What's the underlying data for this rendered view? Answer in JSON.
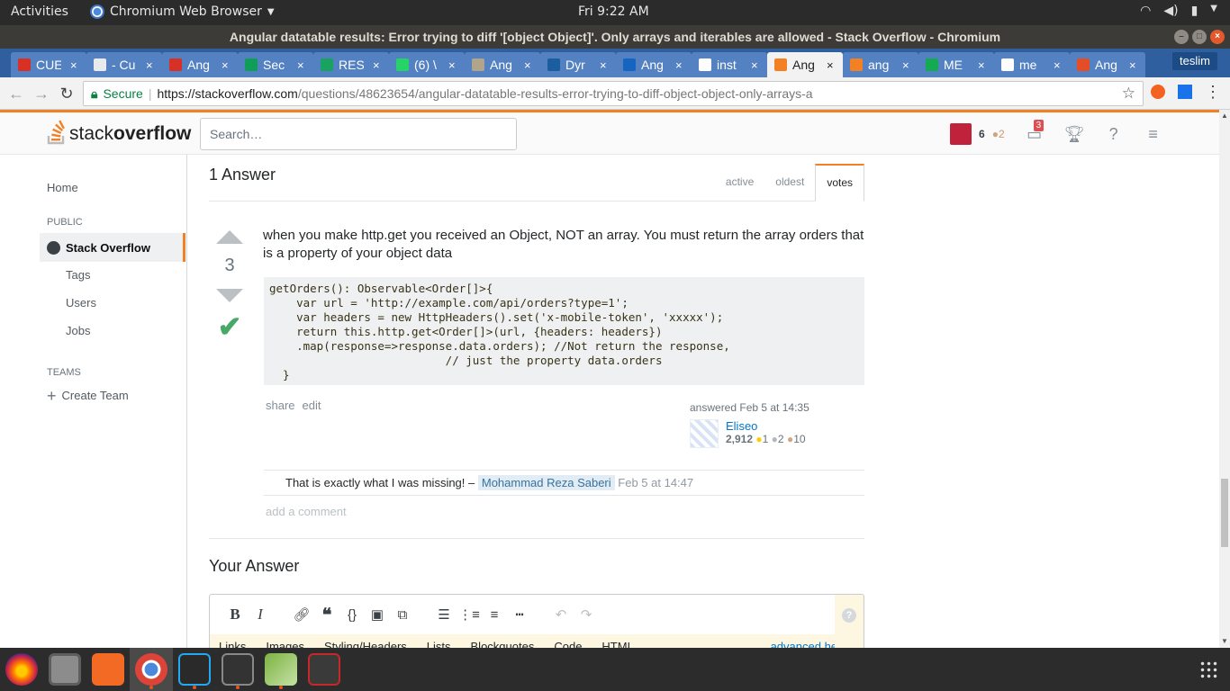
{
  "system": {
    "activities": "Activities",
    "app_name": "Chromium Web Browser",
    "clock": "Fri  9:22 AM"
  },
  "window": {
    "title": "Angular datatable results: Error trying to diff '[object Object]'. Only arrays and iterables are allowed - Stack Overflow - Chromium"
  },
  "tabs": [
    {
      "label": "CUE",
      "color": "#d93025"
    },
    {
      "label": "- Cu",
      "color": "#e8eaed"
    },
    {
      "label": "Ang",
      "color": "#d93025"
    },
    {
      "label": "Sec",
      "color": "#0f9d58"
    },
    {
      "label": "RES",
      "color": "#1aa260"
    },
    {
      "label": "(6) \\",
      "color": "#25d366"
    },
    {
      "label": "Ang",
      "color": "#b0a48a"
    },
    {
      "label": "Dyr",
      "color": "#1b5e9f"
    },
    {
      "label": "Ang",
      "color": "#1565c0"
    },
    {
      "label": "inst",
      "color": "#ffffff"
    },
    {
      "label": "Ang",
      "color": "#f48024",
      "active": true
    },
    {
      "label": "ang",
      "color": "#f48024"
    },
    {
      "label": "ME",
      "color": "#13aa52"
    },
    {
      "label": "me",
      "color": "#ffffff"
    },
    {
      "label": "Ang",
      "color": "#e44d26"
    }
  ],
  "profile": "teslim",
  "address_bar": {
    "secure_label": "Secure",
    "url_host": "https://stackoverflow.com",
    "url_path": "/questions/48623654/angular-datatable-results-error-trying-to-diff-object-object-only-arrays-a"
  },
  "so_header": {
    "logo_light": "stack",
    "logo_bold": "overflow",
    "search_placeholder": "Search…",
    "reputation": "6",
    "bronze_badges": "2",
    "inbox_count": "3"
  },
  "sidebar": {
    "home": "Home",
    "public_heading": "PUBLIC",
    "stack_overflow": "Stack Overflow",
    "tags": "Tags",
    "users": "Users",
    "jobs": "Jobs",
    "teams_heading": "TEAMS",
    "create_team": "Create Team"
  },
  "answers": {
    "count_label": "1 Answer",
    "sort_tabs": [
      "active",
      "oldest",
      "votes"
    ],
    "active_sort": "votes"
  },
  "answer": {
    "votes": "3",
    "accepted": true,
    "text": "when you make http.get you received an Object, NOT an array. You must return the array orders that is a property of your object data",
    "code": "getOrders(): Observable<Order[]>{\n    var url = 'http://example.com/api/orders?type=1';\n    var headers = new HttpHeaders().set('x-mobile-token', 'xxxxx');\n    return this.http.get<Order[]>(url, {headers: headers})\n    .map(response=>response.data.orders); //Not return the response,\n                          // just the property data.orders\n  }",
    "share": "share",
    "edit": "edit",
    "answered_time": "answered Feb 5 at 14:35",
    "user_name": "Eliseo",
    "user_rep": "2,912",
    "gold": "1",
    "silver": "2",
    "bronze": "10"
  },
  "comments": [
    {
      "text": "That is exactly what I was missing! – ",
      "user": "Mohammad Reza Saberi",
      "date": "Feb 5 at 14:47"
    }
  ],
  "add_comment": "add a comment",
  "your_answer": {
    "heading": "Your Answer",
    "editor_tabs": [
      "Links",
      "Images",
      "Styling/Headers",
      "Lists",
      "Blockquotes",
      "Code",
      "HTML"
    ],
    "advanced_help": "advanced help »",
    "toolbar_icons": [
      "bold-icon",
      "italic-icon",
      "link-icon",
      "blockquote-icon",
      "code-icon",
      "image-icon",
      "snippet-icon",
      "numbered-list-icon",
      "bulleted-list-icon",
      "heading-icon",
      "horizontal-rule-icon",
      "undo-icon",
      "redo-icon"
    ]
  },
  "colors": {
    "so_orange": "#f48024",
    "accept_green": "#48a868",
    "link_blue": "#0077cc"
  }
}
